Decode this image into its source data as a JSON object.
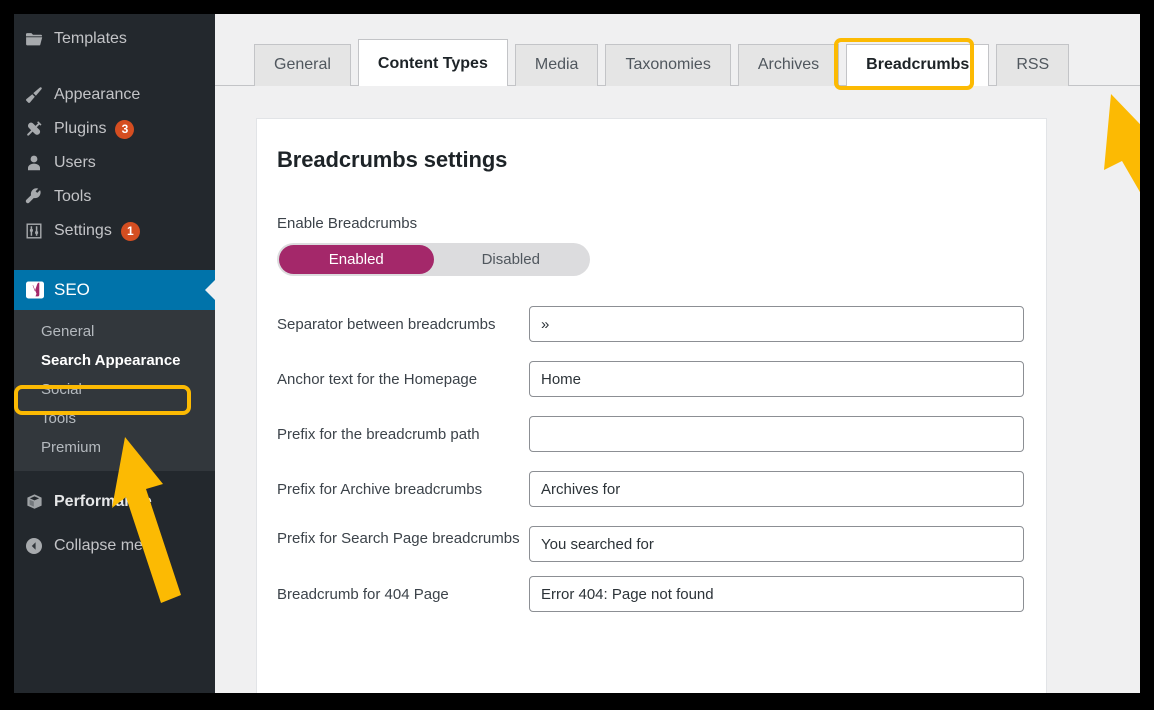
{
  "theme": {
    "sidebar_bg": "#23282d",
    "submenu_bg": "#32373c",
    "active_blue": "#0073aa",
    "highlight_yellow": "#fcba03",
    "toggle_on": "#a4286a",
    "badge_red": "#d54e21",
    "content_bg": "#f0f0f1"
  },
  "sidebar": {
    "items": [
      {
        "label": "Templates",
        "icon": "folder-icon",
        "badge": null,
        "active": false
      },
      {
        "label": "Appearance",
        "icon": "paintbrush-icon",
        "badge": null,
        "active": false
      },
      {
        "label": "Plugins",
        "icon": "plug-icon",
        "badge": "3",
        "active": false
      },
      {
        "label": "Users",
        "icon": "user-icon",
        "badge": null,
        "active": false
      },
      {
        "label": "Tools",
        "icon": "wrench-icon",
        "badge": null,
        "active": false
      },
      {
        "label": "Settings",
        "icon": "sliders-icon",
        "badge": "1",
        "active": false
      },
      {
        "label": "SEO",
        "icon": "yoast-icon",
        "badge": null,
        "active": true
      }
    ],
    "submenu": [
      {
        "label": "General",
        "current": false
      },
      {
        "label": "Search Appearance",
        "current": true
      },
      {
        "label": "Social",
        "current": false
      },
      {
        "label": "Tools",
        "current": false
      },
      {
        "label": "Premium",
        "current": false
      }
    ],
    "footer_items": [
      {
        "label": "Performance",
        "icon": "box-icon"
      },
      {
        "label": "Collapse menu",
        "icon": "collapse-left-icon"
      }
    ]
  },
  "tabs": [
    {
      "label": "General",
      "state": "normal"
    },
    {
      "label": "Content Types",
      "state": "active"
    },
    {
      "label": "Media",
      "state": "normal"
    },
    {
      "label": "Taxonomies",
      "state": "normal"
    },
    {
      "label": "Archives",
      "state": "normal"
    },
    {
      "label": "Breadcrumbs",
      "state": "highlighted"
    },
    {
      "label": "RSS",
      "state": "normal"
    }
  ],
  "card": {
    "title": "Breadcrumbs settings",
    "enable_label": "Enable Breadcrumbs",
    "toggle": {
      "enabled_label": "Enabled",
      "disabled_label": "Disabled",
      "selected": "Enabled"
    },
    "fields": [
      {
        "label": "Separator between breadcrumbs",
        "value": "»",
        "placeholder": ""
      },
      {
        "label": "Anchor text for the Homepage",
        "value": "Home",
        "placeholder": ""
      },
      {
        "label": "Prefix for the breadcrumb path",
        "value": "",
        "placeholder": ""
      },
      {
        "label": "Prefix for Archive breadcrumbs",
        "value": "Archives for",
        "placeholder": ""
      },
      {
        "label": "Prefix for Search Page breadcrumbs",
        "value": "You searched for",
        "placeholder": ""
      },
      {
        "label": "Breadcrumb for 404 Page",
        "value": "Error 404: Page not found",
        "placeholder": ""
      }
    ]
  },
  "annotations": {
    "tab_arrow": "arrow pointing up-left to Breadcrumbs tab",
    "sidebar_arrow": "arrow pointing up-left to Search Appearance"
  }
}
